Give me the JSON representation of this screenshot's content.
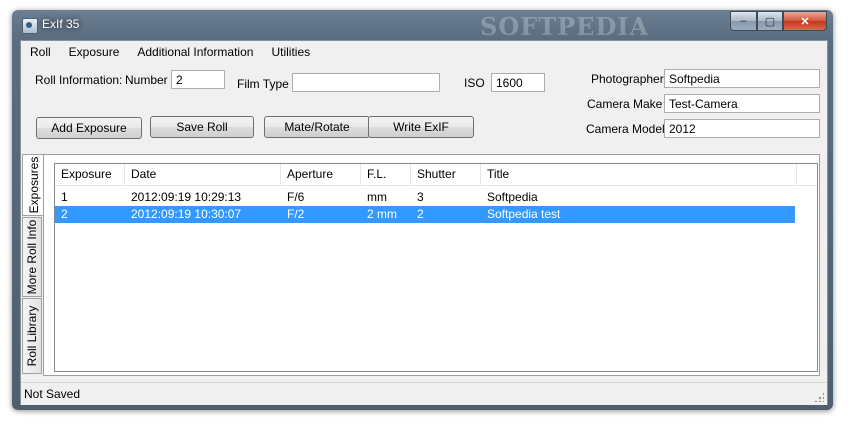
{
  "window": {
    "title": "ExIf 35",
    "watermark": "SOFTPEDIA"
  },
  "caption_buttons": {
    "minimize": "–",
    "maximize": "▢",
    "close": "✕"
  },
  "menu": [
    "Roll",
    "Exposure",
    "Additional Information",
    "Utilities"
  ],
  "roll_info": {
    "label": "Roll Information:",
    "number_label": "Number",
    "number_value": "2",
    "film_type_label": "Film Type",
    "film_type_value": "",
    "iso_label": "ISO",
    "iso_value": "1600"
  },
  "camera": {
    "photographer_label": "Photographer",
    "photographer_value": "Softpedia",
    "make_label": "Camera Make",
    "make_value": "Test-Camera",
    "model_label": "Camera Model",
    "model_value": "2012"
  },
  "buttons": {
    "add_exposure": "Add Exposure",
    "save_roll": "Save Roll",
    "mate_rotate": "Mate/Rotate",
    "write_exif": "Write ExIF"
  },
  "tabs": [
    "Exposures",
    "More Roll Info",
    "Roll Library"
  ],
  "list": {
    "columns": [
      "Exposure",
      "Date",
      "Aperture",
      "F.L.",
      "Shutter",
      "Title"
    ],
    "rows": [
      [
        "1",
        "2012:09:19 10:29:13",
        "F/6",
        "mm",
        "3",
        "Softpedia"
      ],
      [
        "2",
        "2012:09:19 10:30:07",
        "F/2",
        "2 mm",
        "2",
        "Softpedia test"
      ]
    ],
    "selected_row": 2
  },
  "status": {
    "text": "Not Saved"
  },
  "colors": {
    "selection": "#3399ff",
    "title_bar": "#5b6d80"
  }
}
